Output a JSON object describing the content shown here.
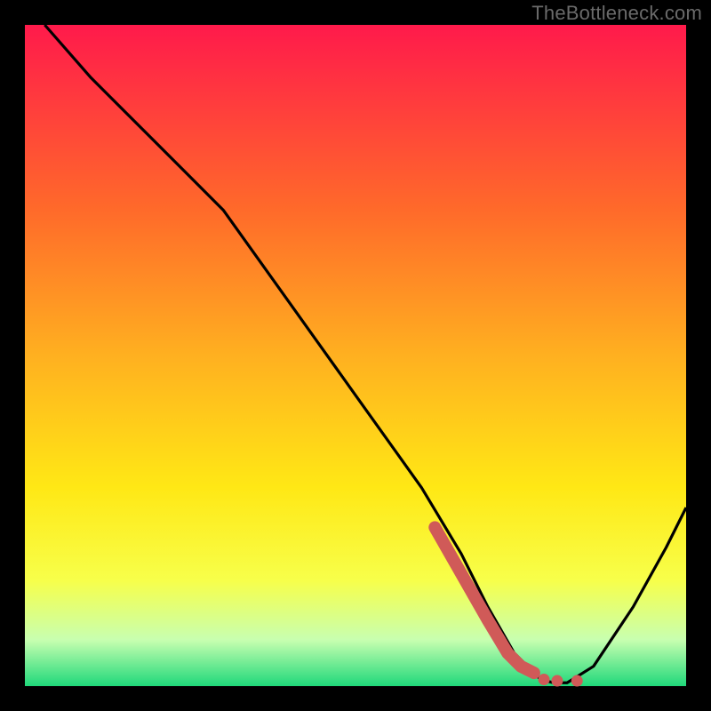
{
  "watermark": "TheBottleneck.com",
  "colors": {
    "gradient_top": "#ff1a4b",
    "gradient_mid1": "#ff6a2a",
    "gradient_mid2": "#ffb020",
    "gradient_mid3": "#ffe815",
    "gradient_mid4": "#f7ff4a",
    "gradient_low": "#c8ffb0",
    "gradient_bottom": "#1fd87a",
    "frame": "#000000",
    "curve": "#000000",
    "marker_stroke": "#d05a58",
    "marker_dot": "#d05a58"
  },
  "frame_thickness": 28,
  "chart_data": {
    "type": "line",
    "title": "",
    "xlabel": "",
    "ylabel": "",
    "xlim": [
      0,
      100
    ],
    "ylim": [
      0,
      100
    ],
    "grid": false,
    "series": [
      {
        "name": "bottleneck-curve",
        "x": [
          3,
          10,
          18,
          24,
          30,
          40,
          50,
          60,
          66,
          70,
          74,
          78,
          80,
          82,
          86,
          92,
          97,
          100
        ],
        "y": [
          100,
          92,
          84,
          78,
          72,
          58,
          44,
          30,
          20,
          12,
          5,
          1,
          0.5,
          0.5,
          3,
          12,
          21,
          27
        ]
      }
    ],
    "highlight_segment": {
      "name": "bottleneck-indicator",
      "x": [
        62,
        66,
        70,
        73,
        75,
        77
      ],
      "y": [
        24,
        17,
        10,
        5,
        3,
        2
      ]
    },
    "highlight_dots": {
      "name": "valley-dots",
      "points": [
        {
          "x": 78.5,
          "y": 1.0
        },
        {
          "x": 80.5,
          "y": 0.8
        },
        {
          "x": 83.5,
          "y": 0.8
        }
      ]
    }
  }
}
